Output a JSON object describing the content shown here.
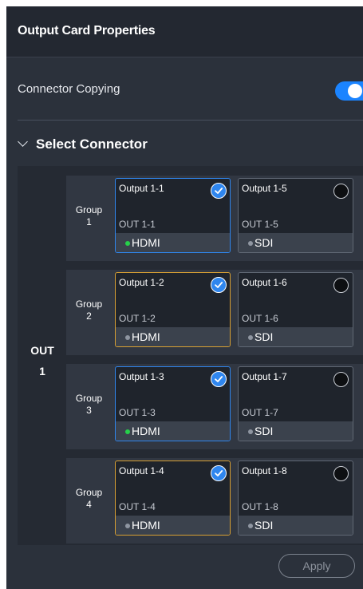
{
  "panel": {
    "title": "Output Card Properties",
    "connector_copying": {
      "label": "Connector Copying",
      "enabled": true
    }
  },
  "section": {
    "title": "Select Connector"
  },
  "out": {
    "name": "OUT",
    "number": "1"
  },
  "groups": [
    {
      "label": "Group",
      "number": "1",
      "cards": [
        {
          "title": "Output 1-1",
          "sub": "OUT 1-1",
          "type": "HDMI",
          "selected": true,
          "highlight": "blue",
          "status": "green"
        },
        {
          "title": "Output 1-5",
          "sub": "OUT 1-5",
          "type": "SDI",
          "selected": false,
          "highlight": "none",
          "status": "gray"
        }
      ]
    },
    {
      "label": "Group",
      "number": "2",
      "cards": [
        {
          "title": "Output 1-2",
          "sub": "OUT 1-2",
          "type": "HDMI",
          "selected": true,
          "highlight": "orange",
          "status": "gray"
        },
        {
          "title": "Output 1-6",
          "sub": "OUT 1-6",
          "type": "SDI",
          "selected": false,
          "highlight": "none",
          "status": "gray"
        }
      ]
    },
    {
      "label": "Group",
      "number": "3",
      "cards": [
        {
          "title": "Output 1-3",
          "sub": "OUT 1-3",
          "type": "HDMI",
          "selected": true,
          "highlight": "blue",
          "status": "green"
        },
        {
          "title": "Output 1-7",
          "sub": "OUT 1-7",
          "type": "SDI",
          "selected": false,
          "highlight": "none",
          "status": "gray"
        }
      ]
    },
    {
      "label": "Group",
      "number": "4",
      "cards": [
        {
          "title": "Output 1-4",
          "sub": "OUT 1-4",
          "type": "HDMI",
          "selected": true,
          "highlight": "orange",
          "status": "gray"
        },
        {
          "title": "Output 1-8",
          "sub": "OUT 1-8",
          "type": "SDI",
          "selected": false,
          "highlight": "none",
          "status": "gray"
        }
      ]
    }
  ],
  "apply_label": "Apply",
  "colors": {
    "accent": "#1b84ff",
    "selected_blue": "#2f86ee",
    "selected_orange": "#d8a033",
    "status_green": "#26d04a"
  },
  "icons": {
    "section_toggle": "chevron-down-icon",
    "selected": "check-circle-icon",
    "unselected": "radio-empty-icon",
    "status": "status-dot-icon"
  }
}
